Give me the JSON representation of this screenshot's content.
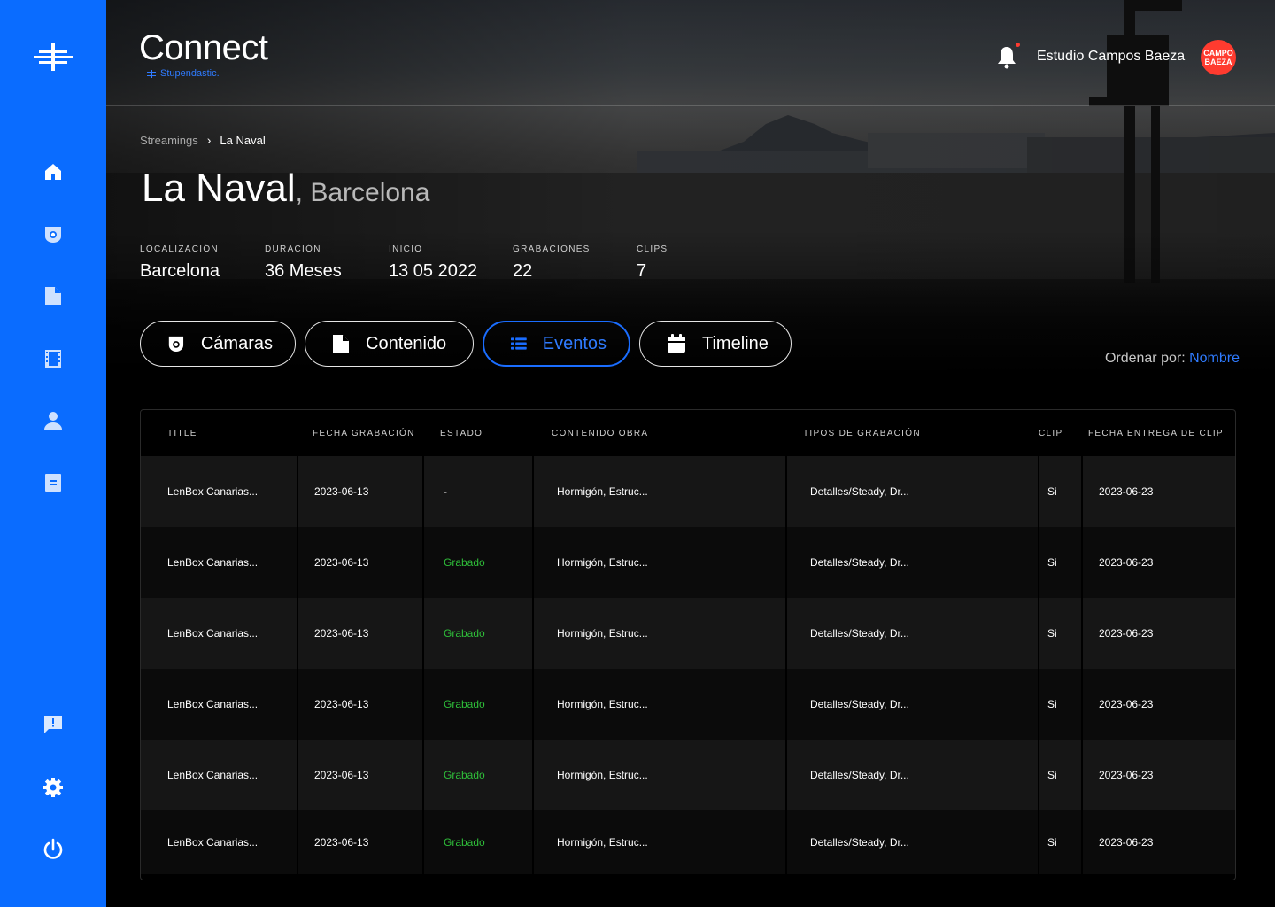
{
  "app": {
    "title": "Connect",
    "subtitle": "Stupendastic."
  },
  "header": {
    "studio_name": "Estudio Campos Baeza",
    "avatar_line1": "CAMPO",
    "avatar_line2": "BAEZA"
  },
  "sidebar": {
    "items": [
      {
        "icon": "home-icon"
      },
      {
        "icon": "camera-icon"
      },
      {
        "icon": "document-icon"
      },
      {
        "icon": "film-icon"
      },
      {
        "icon": "user-icon"
      },
      {
        "icon": "list-icon"
      }
    ],
    "bottom_items": [
      {
        "icon": "feedback-icon"
      },
      {
        "icon": "gear-icon"
      },
      {
        "icon": "power-icon"
      }
    ]
  },
  "breadcrumb": {
    "parent": "Streamings",
    "current": "La Naval"
  },
  "page": {
    "title": "La Naval",
    "subtitle": ", Barcelona"
  },
  "stats": [
    {
      "label": "LOCALIZACIÓN",
      "value": "Barcelona"
    },
    {
      "label": "DURACIÓN",
      "value": "36 Meses"
    },
    {
      "label": "INICIO",
      "value": "13 05 2022"
    },
    {
      "label": "GRABACIONES",
      "value": "22"
    },
    {
      "label": "CLIPS",
      "value": "7"
    }
  ],
  "tabs": [
    {
      "label": "Cámaras",
      "icon": "camera-icon",
      "active": false
    },
    {
      "label": "Contenido",
      "icon": "document-icon",
      "active": false
    },
    {
      "label": "Eventos",
      "icon": "list-icon",
      "active": true
    },
    {
      "label": "Timeline",
      "icon": "calendar-icon",
      "active": false
    }
  ],
  "order": {
    "label": "Ordenar por: ",
    "value": "Nombre"
  },
  "table": {
    "headers": [
      "TITLE",
      "FECHA GRABACIÓN",
      "ESTADO",
      "CONTENIDO OBRA",
      "TIPOS DE GRABACIÓN",
      "CLIP",
      "FECHA ENTREGA DE CLIP"
    ],
    "rows": [
      [
        "LenBox Canarias...",
        "2023-06-13",
        "-",
        "Hormigón, Estruc...",
        "Detalles/Steady, Dr...",
        "Si",
        "2023-06-23"
      ],
      [
        "LenBox Canarias...",
        "2023-06-13",
        "Grabado",
        "Hormigón, Estruc...",
        "Detalles/Steady, Dr...",
        "Si",
        "2023-06-23"
      ],
      [
        "LenBox Canarias...",
        "2023-06-13",
        "Grabado",
        "Hormigón, Estruc...",
        "Detalles/Steady, Dr...",
        "Si",
        "2023-06-23"
      ],
      [
        "LenBox Canarias...",
        "2023-06-13",
        "Grabado",
        "Hormigón, Estruc...",
        "Detalles/Steady, Dr...",
        "Si",
        "2023-06-23"
      ],
      [
        "LenBox Canarias...",
        "2023-06-13",
        "Grabado",
        "Hormigón, Estruc...",
        "Detalles/Steady, Dr...",
        "Si",
        "2023-06-23"
      ],
      [
        "LenBox Canarias...",
        "2023-06-13",
        "Grabado",
        "Hormigón, Estruc...",
        "Detalles/Steady, Dr...",
        "Si",
        "2023-06-23"
      ]
    ]
  },
  "colors": {
    "sidebar": "#0a6cff",
    "accent": "#2f7bff",
    "status_ok": "#2fbf3a",
    "avatar": "#ff3b2f"
  }
}
